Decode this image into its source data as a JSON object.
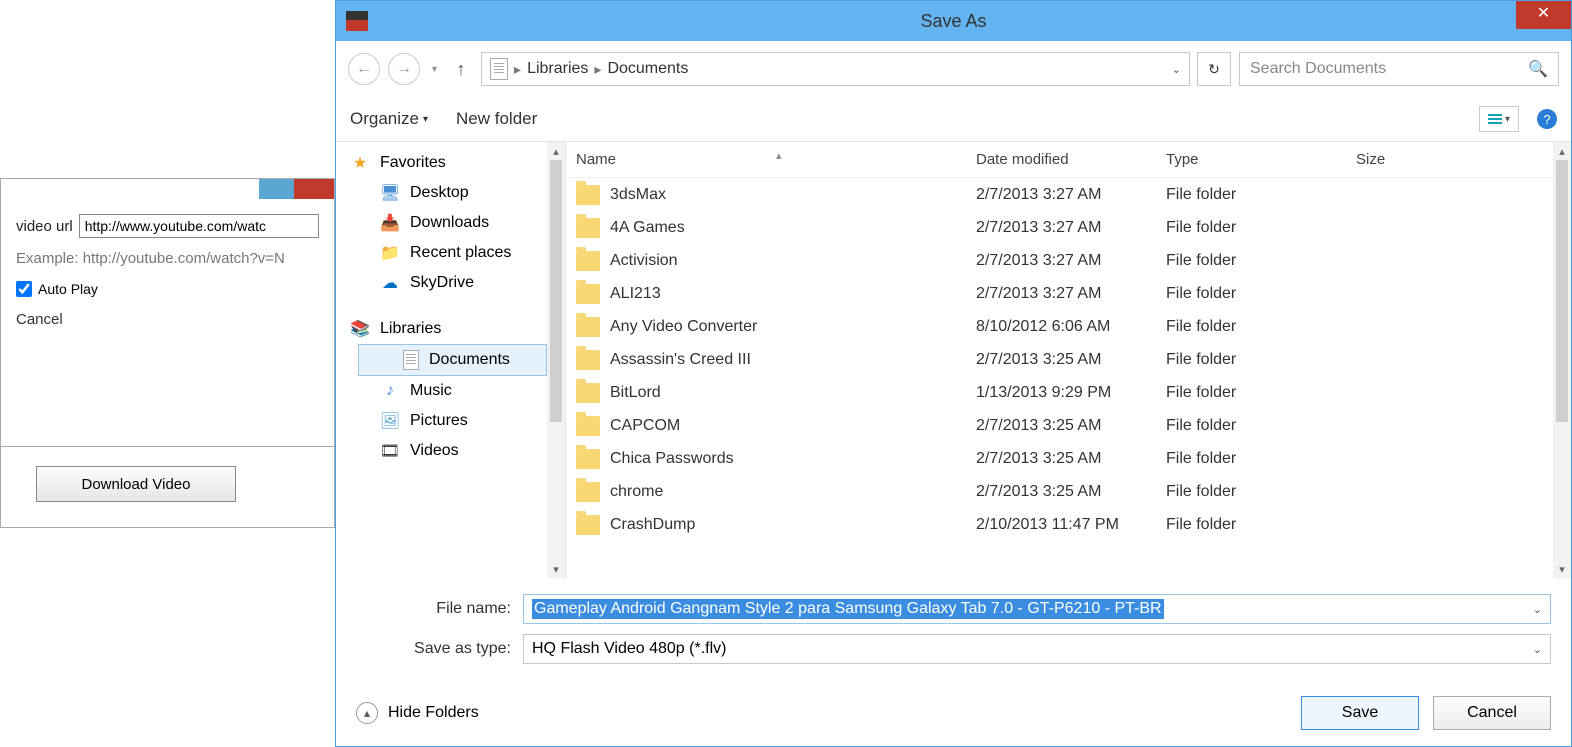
{
  "bg": {
    "video_url_label": "video url",
    "video_url_value": "http://www.youtube.com/watc",
    "example_text": "Example: http://youtube.com/watch?v=N",
    "autoplay_label": "Auto Play",
    "cancel_label": "Cancel",
    "download_button": "Download Video"
  },
  "dialog": {
    "title": "Save As",
    "breadcrumb": {
      "p1": "Libraries",
      "p2": "Documents"
    },
    "search_placeholder": "Search Documents",
    "toolbar": {
      "organize": "Organize",
      "new_folder": "New folder"
    },
    "sidebar": {
      "favorites": "Favorites",
      "desktop": "Desktop",
      "downloads": "Downloads",
      "recent": "Recent places",
      "skydrive": "SkyDrive",
      "libraries": "Libraries",
      "documents": "Documents",
      "music": "Music",
      "pictures": "Pictures",
      "videos": "Videos"
    },
    "columns": {
      "name": "Name",
      "date": "Date modified",
      "type": "Type",
      "size": "Size"
    },
    "files": [
      {
        "name": "3dsMax",
        "date": "2/7/2013 3:27 AM",
        "type": "File folder"
      },
      {
        "name": "4A Games",
        "date": "2/7/2013 3:27 AM",
        "type": "File folder"
      },
      {
        "name": "Activision",
        "date": "2/7/2013 3:27 AM",
        "type": "File folder"
      },
      {
        "name": "ALI213",
        "date": "2/7/2013 3:27 AM",
        "type": "File folder"
      },
      {
        "name": "Any Video Converter",
        "date": "8/10/2012 6:06 AM",
        "type": "File folder"
      },
      {
        "name": "Assassin's Creed III",
        "date": "2/7/2013 3:25 AM",
        "type": "File folder"
      },
      {
        "name": "BitLord",
        "date": "1/13/2013 9:29 PM",
        "type": "File folder"
      },
      {
        "name": "CAPCOM",
        "date": "2/7/2013 3:25 AM",
        "type": "File folder"
      },
      {
        "name": "Chica Passwords",
        "date": "2/7/2013 3:25 AM",
        "type": "File folder"
      },
      {
        "name": "chrome",
        "date": "2/7/2013 3:25 AM",
        "type": "File folder"
      },
      {
        "name": "CrashDump",
        "date": "2/10/2013 11:47 PM",
        "type": "File folder"
      }
    ],
    "file_name_label": "File name:",
    "file_name_value": "Gameplay Android Gangnam Style 2 para Samsung Galaxy Tab 7.0 - GT-P6210 - PT-BR",
    "file_type_label": "Save as type:",
    "file_type_value": "HQ Flash Video 480p (*.flv)",
    "hide_folders": "Hide Folders",
    "save_label": "Save",
    "cancel_label": "Cancel"
  }
}
